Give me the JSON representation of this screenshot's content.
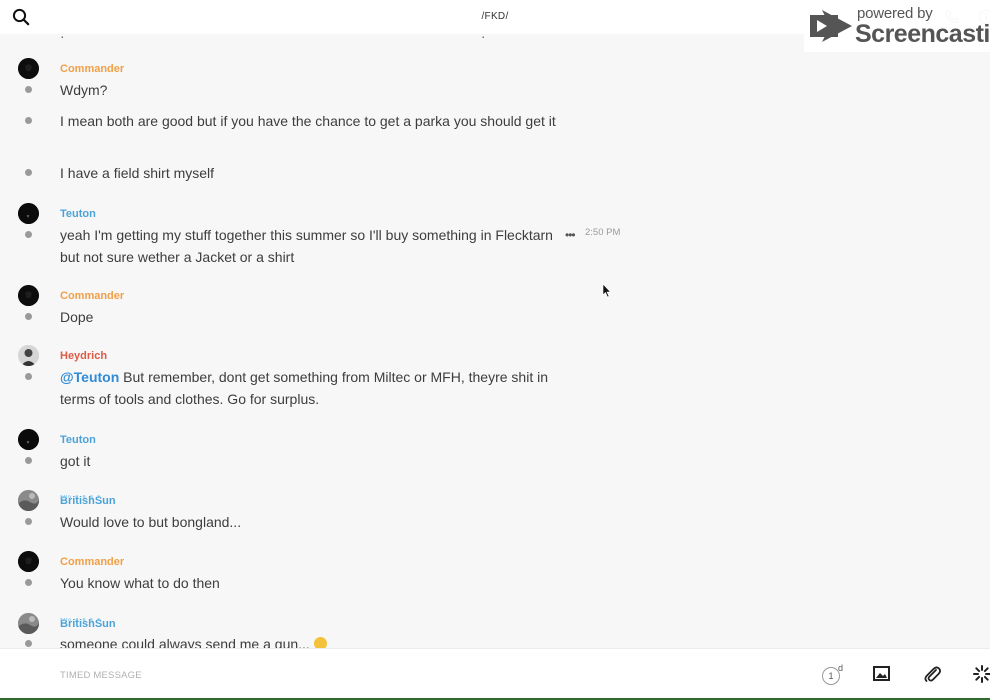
{
  "header": {
    "title": "/FKD/"
  },
  "watermark": {
    "line1": "powered by",
    "line2": "Screencastify"
  },
  "feed": {
    "messages": [
      {
        "author": "Commander",
        "color": "#f0a046",
        "lines": [
          "Wdym?",
          "I mean both are good but if you have the chance to get a parka you should get it",
          "I have a field shirt myself"
        ]
      },
      {
        "author": "Teuton",
        "color": "#4aa3d8",
        "lines": [
          "yeah I'm getting my stuff together this summer so I'll buy something in Flecktarn but not sure wether a Jacket or a shirt"
        ],
        "time": "2:50 PM"
      },
      {
        "author": "Commander",
        "color": "#f0a046",
        "lines": [
          "Dope"
        ]
      },
      {
        "author": "Heydrich",
        "color": "#dd5a43",
        "mention": "@Teuton",
        "lines": [
          " But remember, dont get something from Miltec or MFH, theyre shit in terms of tools and clothes. Go for surplus."
        ]
      },
      {
        "author": "Teuton",
        "color": "#4aa3d8",
        "lines": [
          "got it"
        ]
      },
      {
        "author": "BritishSun",
        "color": "#4aa3d8",
        "lines": [
          "Would love to but bongland..."
        ]
      },
      {
        "author": "Commander",
        "color": "#f0a046",
        "lines": [
          "You know what to do then"
        ]
      },
      {
        "author": "BritishSun",
        "color": "#4aa3d8",
        "lines": [
          "someone could always send me a gun... "
        ]
      }
    ]
  },
  "composer": {
    "placeholder": "TIMED MESSAGE",
    "timer_value": "1",
    "timer_unit": "d"
  },
  "icons": {
    "search": "search-icon",
    "phone": "phone-icon",
    "info": "info-icon",
    "image": "image-icon",
    "attach": "paperclip-icon",
    "more": "spinner-icon"
  }
}
